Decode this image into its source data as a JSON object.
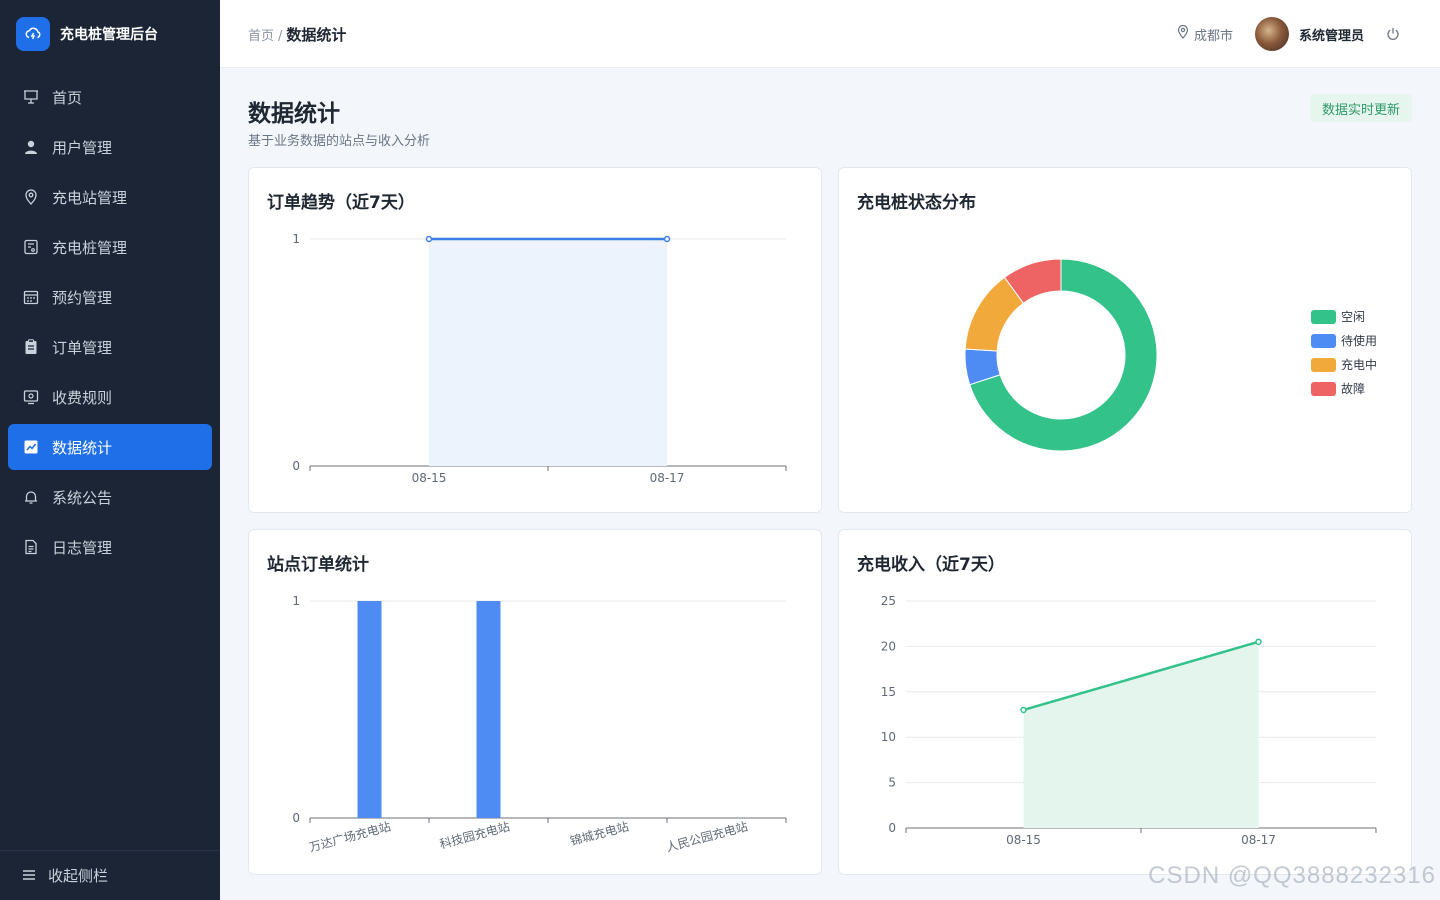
{
  "app": {
    "title": "充电桩管理后台",
    "logo_icon": "cloud-lightning-icon",
    "accent": "#1f6fe8"
  },
  "sidebar": {
    "items": [
      {
        "label": "首页",
        "icon": "presentation-icon",
        "active": false
      },
      {
        "label": "用户管理",
        "icon": "user-icon",
        "active": false
      },
      {
        "label": "充电站管理",
        "icon": "location-pin-icon",
        "active": false
      },
      {
        "label": "充电桩管理",
        "icon": "charger-icon",
        "active": false
      },
      {
        "label": "预约管理",
        "icon": "calendar-icon",
        "active": false
      },
      {
        "label": "订单管理",
        "icon": "clipboard-icon",
        "active": false
      },
      {
        "label": "收费规则",
        "icon": "monitor-icon",
        "active": false
      },
      {
        "label": "数据统计",
        "icon": "chart-icon",
        "active": true
      },
      {
        "label": "系统公告",
        "icon": "bell-icon",
        "active": false
      },
      {
        "label": "日志管理",
        "icon": "document-icon",
        "active": false
      }
    ],
    "collapse_label": "收起侧栏"
  },
  "header": {
    "breadcrumb_home": "首页",
    "breadcrumb_sep": "/",
    "breadcrumb_current": "数据统计",
    "city": "成都市",
    "username": "系统管理员"
  },
  "page": {
    "title": "数据统计",
    "subtitle": "基于业务数据的站点与收入分析",
    "realtime_badge": "数据实时更新"
  },
  "cards": {
    "orders_trend": "订单趋势（近7天）",
    "pile_status": "充电桩状态分布",
    "station_orders": "站点订单统计",
    "revenue": "充电收入（近7天）"
  },
  "watermark": "CSDN @QQ3888232316",
  "chart_data": [
    {
      "type": "area",
      "title": "订单趋势（近7天）",
      "x": [
        "08-15",
        "08-17"
      ],
      "values": [
        1,
        1
      ],
      "ylim": [
        0,
        1
      ],
      "yticks": [
        0,
        1
      ],
      "color": "#3b7ee6",
      "fill": "#edf3fd"
    },
    {
      "type": "pie",
      "title": "充电桩状态分布",
      "donut": true,
      "legend_position": "right",
      "slices": [
        {
          "label": "空闲",
          "value": 70,
          "color": "#32c28a"
        },
        {
          "label": "待使用",
          "value": 6,
          "color": "#4e8cf4"
        },
        {
          "label": "充电中",
          "value": 14,
          "color": "#f2a93b"
        },
        {
          "label": "故障",
          "value": 10,
          "color": "#ee6464"
        }
      ]
    },
    {
      "type": "bar",
      "title": "站点订单统计",
      "categories": [
        "万达广场充电站",
        "科技园充电站",
        "锦城充电站",
        "人民公园充电站"
      ],
      "values": [
        1,
        1,
        0,
        0
      ],
      "ylim": [
        0,
        1
      ],
      "yticks": [
        0,
        1
      ],
      "color": "#4e8cf4"
    },
    {
      "type": "area",
      "title": "充电收入（近7天）",
      "x": [
        "08-15",
        "08-17"
      ],
      "values": [
        13,
        20.5
      ],
      "ylim": [
        0,
        25
      ],
      "yticks": [
        0,
        5,
        10,
        15,
        20,
        25
      ],
      "color": "#32c28a",
      "fill": "#e4f5ee"
    }
  ]
}
